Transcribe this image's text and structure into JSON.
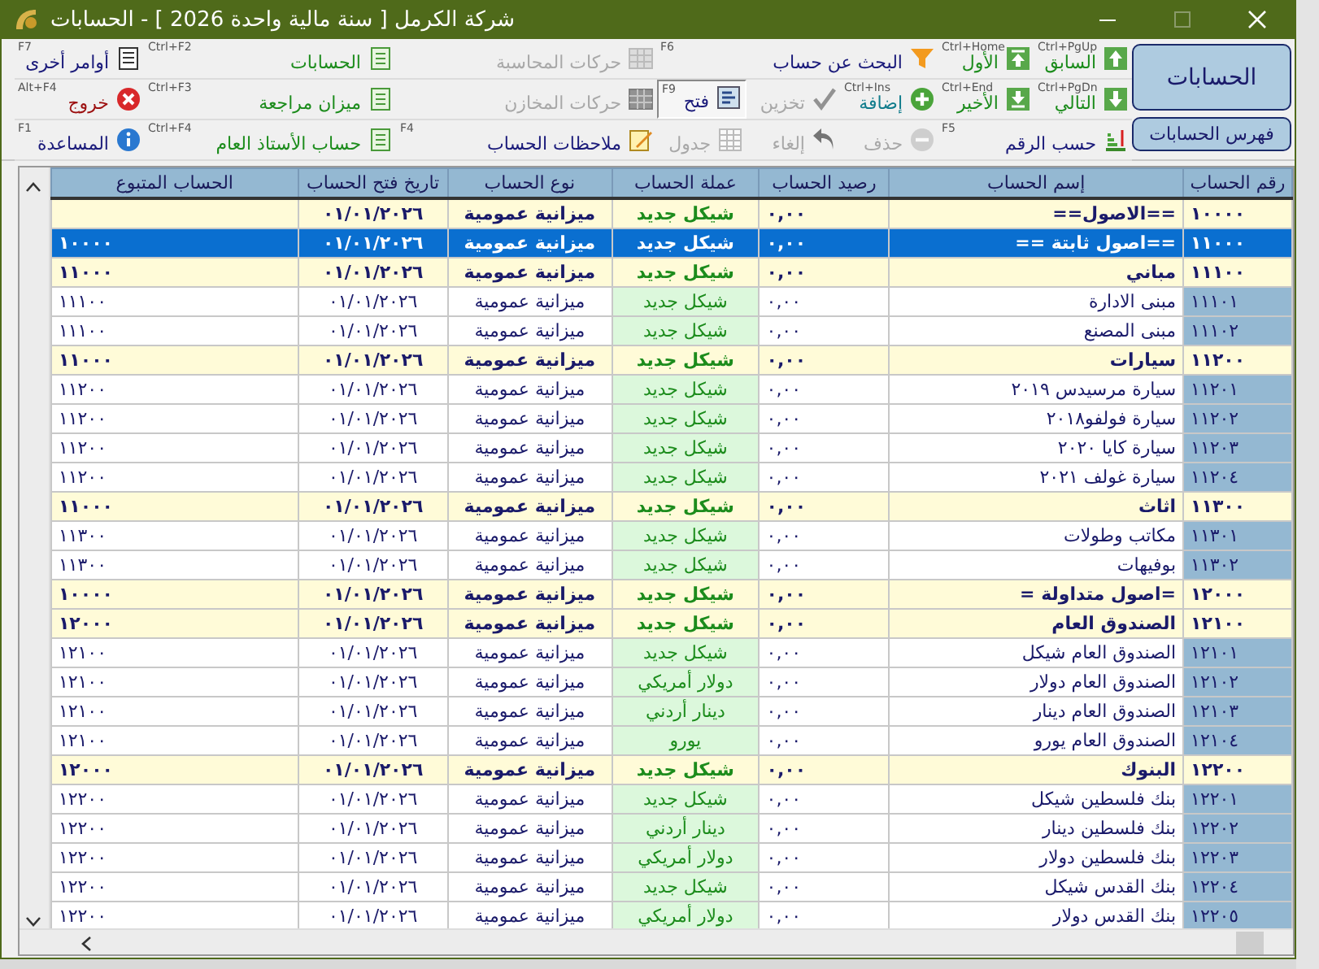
{
  "window": {
    "title": "شركة الكرمل [ سنة مالية واحدة 2026 ] - الحسابات"
  },
  "side_buttons": [
    "الحسابات",
    "فهرس الحسابات"
  ],
  "toolbar": [
    {
      "label": "السابق",
      "shortcut": "Ctrl+PgUp",
      "disabled": false,
      "highlighted": false,
      "color": "#1c8c1c"
    },
    {
      "label": "الأول",
      "shortcut": "Ctrl+Home",
      "disabled": false,
      "highlighted": false,
      "color": "#1c8c1c"
    },
    {
      "label": "البحث عن حساب",
      "shortcut": "F6",
      "disabled": false,
      "highlighted": false,
      "color": "#1a1a7a"
    },
    {
      "label": "حركات المحاسبة",
      "disabled": true,
      "highlighted": false
    },
    {
      "label": "الحسابات",
      "shortcut": "Ctrl+F2",
      "disabled": false,
      "highlighted": false,
      "color": "#1c8c1c"
    },
    {
      "label": "أوامر أخرى",
      "shortcut": "F7",
      "disabled": false,
      "highlighted": false,
      "color": "#1a1a7a"
    },
    {
      "label": "التالي",
      "shortcut": "Ctrl+PgDn",
      "disabled": false,
      "highlighted": false,
      "color": "#1c8c1c"
    },
    {
      "label": "الأخير",
      "shortcut": "Ctrl+End",
      "disabled": false,
      "highlighted": false,
      "color": "#1c8c1c"
    },
    {
      "label": "إضافة",
      "shortcut": "Ctrl+Ins",
      "disabled": false,
      "highlighted": false,
      "color": "#107c8c"
    },
    {
      "label": "تخزين",
      "disabled": true,
      "highlighted": false
    },
    {
      "label": "فتح",
      "shortcut": "F9",
      "disabled": false,
      "highlighted": true,
      "color": "#1a1a7a"
    },
    {
      "label": "حركات المخازن",
      "disabled": true,
      "highlighted": false
    },
    {
      "label": "ميزان مراجعة",
      "shortcut": "Ctrl+F3",
      "disabled": false,
      "highlighted": false,
      "color": "#1c8c1c"
    },
    {
      "label": "خروج",
      "shortcut": "Alt+F4",
      "disabled": false,
      "highlighted": false,
      "color": "#9c1010"
    },
    {
      "label": "حسب الرقم",
      "shortcut": "F5",
      "disabled": false,
      "highlighted": false,
      "color": "#1a1a7a"
    },
    {
      "label": "حذف",
      "disabled": true,
      "highlighted": false
    },
    {
      "label": "إلغاء",
      "disabled": true,
      "highlighted": false
    },
    {
      "label": "جدول",
      "disabled": true,
      "highlighted": false
    },
    {
      "label": "ملاحظات الحساب",
      "shortcut": "F4",
      "disabled": false,
      "highlighted": false,
      "color": "#1a1a7a"
    },
    {
      "label": "حساب الأستاذ العام",
      "shortcut": "Ctrl+F4",
      "disabled": false,
      "highlighted": false,
      "color": "#1c8c1c"
    },
    {
      "label": "المساعدة",
      "shortcut": "F1",
      "disabled": false,
      "highlighted": false,
      "color": "#1a1a7a"
    }
  ],
  "table": {
    "columns": [
      "رقم الحساب",
      "إسم الحساب",
      "رصيد الحساب",
      "عملة الحساب",
      "نوع الحساب",
      "تاريخ فتح الحساب",
      "الحساب المتبوع"
    ],
    "rows": [
      {
        "kind": "group",
        "selected": false,
        "number": "١٠٠٠٠",
        "name": "==الاصول==",
        "balance": "٠,٠٠",
        "currency": "شيكل جديد",
        "type": "ميزانية عمومية",
        "opened": "٠١/٠١/٢٠٢٦"
      },
      {
        "kind": "group",
        "selected": true,
        "number": "١١٠٠٠",
        "name": "==اصول ثابتة ==",
        "balance": "٠,٠٠",
        "currency": "شيكل جديد",
        "type": "ميزانية عمومية",
        "opened": "٠١/٠١/٢٠٢٦",
        "parent": "١٠٠٠٠"
      },
      {
        "kind": "group",
        "selected": false,
        "number": "١١١٠٠",
        "name": "مباني",
        "balance": "٠,٠٠",
        "currency": "شيكل جديد",
        "type": "ميزانية عمومية",
        "opened": "٠١/٠١/٢٠٢٦",
        "parent": "١١٠٠٠"
      },
      {
        "kind": "account",
        "selected": false,
        "number": "١١١٠١",
        "name": "مبنى الادارة",
        "balance": "٠,٠٠",
        "currency": "شيكل جديد",
        "type": "ميزانية عمومية",
        "opened": "٠١/٠١/٢٠٢٦",
        "parent": "١١١٠٠"
      },
      {
        "kind": "account",
        "selected": false,
        "number": "١١١٠٢",
        "name": "مبنى المصنع",
        "balance": "٠,٠٠",
        "currency": "شيكل جديد",
        "type": "ميزانية عمومية",
        "opened": "٠١/٠١/٢٠٢٦",
        "parent": "١١١٠٠"
      },
      {
        "kind": "group",
        "selected": false,
        "number": "١١٢٠٠",
        "name": "سيارات",
        "balance": "٠,٠٠",
        "currency": "شيكل جديد",
        "type": "ميزانية عمومية",
        "opened": "٠١/٠١/٢٠٢٦",
        "parent": "١١٠٠٠"
      },
      {
        "kind": "account",
        "selected": false,
        "number": "١١٢٠١",
        "name": "سيارة مرسيدس ٢٠١٩",
        "balance": "٠,٠٠",
        "currency": "شيكل جديد",
        "type": "ميزانية عمومية",
        "opened": "٠١/٠١/٢٠٢٦",
        "parent": "١١٢٠٠"
      },
      {
        "kind": "account",
        "selected": false,
        "number": "١١٢٠٢",
        "name": "سيارة فولفو٢٠١٨",
        "balance": "٠,٠٠",
        "currency": "شيكل جديد",
        "type": "ميزانية عمومية",
        "opened": "٠١/٠١/٢٠٢٦",
        "parent": "١١٢٠٠"
      },
      {
        "kind": "account",
        "selected": false,
        "number": "١١٢٠٣",
        "name": "سيارة كايا ٢٠٢٠",
        "balance": "٠,٠٠",
        "currency": "شيكل جديد",
        "type": "ميزانية عمومية",
        "opened": "٠١/٠١/٢٠٢٦",
        "parent": "١١٢٠٠"
      },
      {
        "kind": "account",
        "selected": false,
        "number": "١١٢٠٤",
        "name": "سيارة غولف ٢٠٢١",
        "balance": "٠,٠٠",
        "currency": "شيكل جديد",
        "type": "ميزانية عمومية",
        "opened": "٠١/٠١/٢٠٢٦",
        "parent": "١١٢٠٠"
      },
      {
        "kind": "group",
        "selected": false,
        "number": "١١٣٠٠",
        "name": "اثاث",
        "balance": "٠,٠٠",
        "currency": "شيكل جديد",
        "type": "ميزانية عمومية",
        "opened": "٠١/٠١/٢٠٢٦",
        "parent": "١١٠٠٠"
      },
      {
        "kind": "account",
        "selected": false,
        "number": "١١٣٠١",
        "name": "مكاتب وطولات",
        "balance": "٠,٠٠",
        "currency": "شيكل جديد",
        "type": "ميزانية عمومية",
        "opened": "٠١/٠١/٢٠٢٦",
        "parent": "١١٣٠٠"
      },
      {
        "kind": "account",
        "selected": false,
        "number": "١١٣٠٢",
        "name": "بوفيهات",
        "balance": "٠,٠٠",
        "currency": "شيكل جديد",
        "type": "ميزانية عمومية",
        "opened": "٠١/٠١/٢٠٢٦",
        "parent": "١١٣٠٠"
      },
      {
        "kind": "group",
        "selected": false,
        "number": "١٢٠٠٠",
        "name": "=اصول متداولة =",
        "balance": "٠,٠٠",
        "currency": "شيكل جديد",
        "type": "ميزانية عمومية",
        "opened": "٠١/٠١/٢٠٢٦",
        "parent": "١٠٠٠٠"
      },
      {
        "kind": "group",
        "selected": false,
        "number": "١٢١٠٠",
        "name": "الصندوق العام",
        "balance": "٠,٠٠",
        "currency": "شيكل جديد",
        "type": "ميزانية عمومية",
        "opened": "٠١/٠١/٢٠٢٦",
        "parent": "١٢٠٠٠"
      },
      {
        "kind": "account",
        "selected": false,
        "number": "١٢١٠١",
        "name": "الصندوق العام شيكل",
        "balance": "٠,٠٠",
        "currency": "شيكل جديد",
        "type": "ميزانية عمومية",
        "opened": "٠١/٠١/٢٠٢٦",
        "parent": "١٢١٠٠"
      },
      {
        "kind": "account",
        "selected": false,
        "number": "١٢١٠٢",
        "name": "الصندوق العام دولار",
        "balance": "٠,٠٠",
        "currency": "دولار أمريكي",
        "type": "ميزانية عمومية",
        "opened": "٠١/٠١/٢٠٢٦",
        "parent": "١٢١٠٠"
      },
      {
        "kind": "account",
        "selected": false,
        "number": "١٢١٠٣",
        "name": "الصندوق العام دينار",
        "balance": "٠,٠٠",
        "currency": "دينار أردني",
        "type": "ميزانية عمومية",
        "opened": "٠١/٠١/٢٠٢٦",
        "parent": "١٢١٠٠"
      },
      {
        "kind": "account",
        "selected": false,
        "number": "١٢١٠٤",
        "name": "الصندوق العام يورو",
        "balance": "٠,٠٠",
        "currency": "يورو",
        "type": "ميزانية عمومية",
        "opened": "٠١/٠١/٢٠٢٦",
        "parent": "١٢١٠٠"
      },
      {
        "kind": "group",
        "selected": false,
        "number": "١٢٢٠٠",
        "name": "البنوك",
        "balance": "٠,٠٠",
        "currency": "شيكل جديد",
        "type": "ميزانية عمومية",
        "opened": "٠١/٠١/٢٠٢٦",
        "parent": "١٢٠٠٠"
      },
      {
        "kind": "account",
        "selected": false,
        "number": "١٢٢٠١",
        "name": "بنك فلسطين شيكل",
        "balance": "٠,٠٠",
        "currency": "شيكل جديد",
        "type": "ميزانية عمومية",
        "opened": "٠١/٠١/٢٠٢٦",
        "parent": "١٢٢٠٠"
      },
      {
        "kind": "account",
        "selected": false,
        "number": "١٢٢٠٢",
        "name": "بنك فلسطين دينار",
        "balance": "٠,٠٠",
        "currency": "دينار أردني",
        "type": "ميزانية عمومية",
        "opened": "٠١/٠١/٢٠٢٦",
        "parent": "١٢٢٠٠"
      },
      {
        "kind": "account",
        "selected": false,
        "number": "١٢٢٠٣",
        "name": "بنك فلسطين دولار",
        "balance": "٠,٠٠",
        "currency": "دولار أمريكي",
        "type": "ميزانية عمومية",
        "opened": "٠١/٠١/٢٠٢٦",
        "parent": "١٢٢٠٠"
      },
      {
        "kind": "account",
        "selected": false,
        "number": "١٢٢٠٤",
        "name": "بنك القدس شيكل",
        "balance": "٠,٠٠",
        "currency": "شيكل جديد",
        "type": "ميزانية عمومية",
        "opened": "٠١/٠١/٢٠٢٦",
        "parent": "١٢٢٠٠"
      },
      {
        "kind": "account",
        "selected": false,
        "number": "١٢٢٠٥",
        "name": "بنك القدس دولار",
        "balance": "٠,٠٠",
        "currency": "دولار أمريكي",
        "type": "ميزانية عمومية",
        "opened": "٠١/٠١/٢٠٢٦",
        "parent": "١٢٢٠٠"
      }
    ]
  }
}
